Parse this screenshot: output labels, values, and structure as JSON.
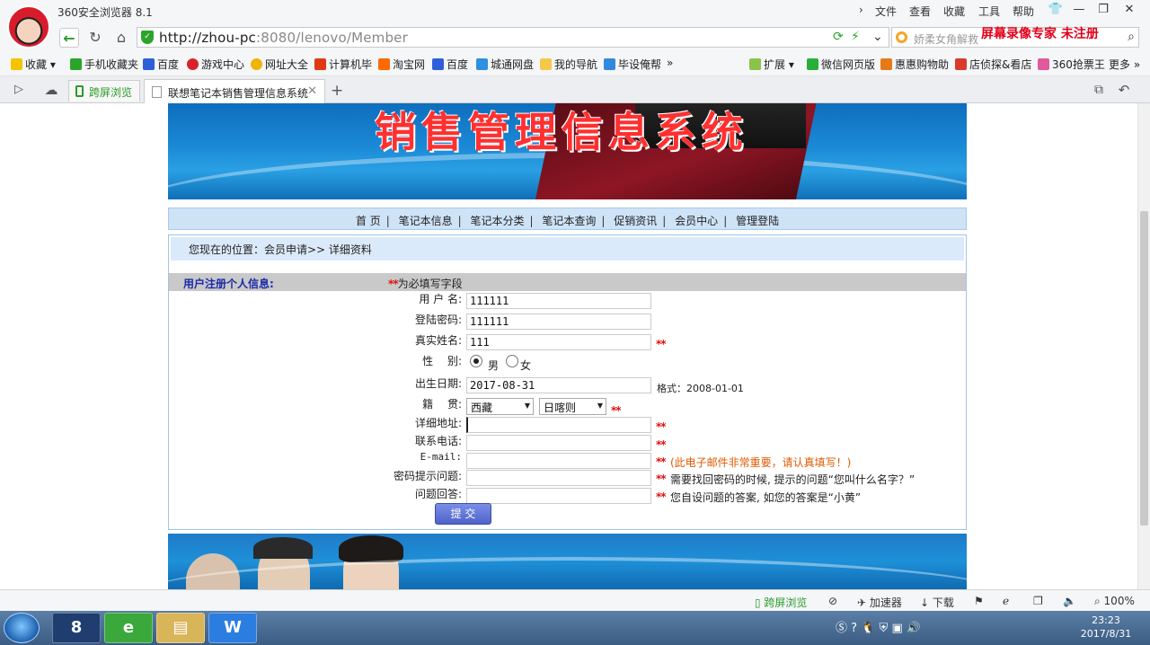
{
  "browser": {
    "app_title": "360安全浏览器 8.1",
    "menus": [
      "文件",
      "查看",
      "收藏",
      "工具",
      "帮助"
    ],
    "url_host": "http://zhou-pc",
    "url_path": ":8080/lenovo/Member",
    "search_placeholder": "娇柔女角解救",
    "watermark": "屏幕录像专家  未注册",
    "bookmarks": [
      "收藏",
      "手机收藏夹",
      "百度",
      "游戏中心",
      "网址大全",
      "计算机毕",
      "淘宝网",
      "百度",
      "城通网盘",
      "我的导航",
      "毕设俺帮"
    ],
    "bookmarks_right": [
      "扩展",
      "微信网页版",
      "惠惠购物助",
      "店侦探&看店",
      "360抢票王",
      "更多"
    ],
    "tabs": {
      "split_label": "跨屏浏览",
      "active_label": "联想笔记本销售管理信息系统"
    },
    "status": {
      "split_label": "跨屏浏览",
      "accelerator": "加速器",
      "download": "下载",
      "zoom": "100%"
    },
    "clock": {
      "time": "23:23",
      "date": "2017/8/31"
    }
  },
  "page": {
    "banner_title": "销售管理信息系统",
    "nav": [
      "首 页",
      "笔记本信息",
      "笔记本分类",
      "笔记本查询",
      "促销资讯",
      "会员中心",
      "管理登陆"
    ],
    "location": "您现在的位置：会员申请>> 详细资料",
    "section_title": "用户注册个人信息:",
    "required_mark": "**",
    "required_note": "为必填写字段",
    "form": {
      "username_label": "用 户 名:",
      "username_value": "111111",
      "password_label": "登陆密码:",
      "password_value": "111111",
      "realname_label": "真实姓名:",
      "realname_value": "111",
      "gender_label": "性　 别:",
      "gender_male": "男",
      "gender_female": "女",
      "gender_selected": "男",
      "birthday_label": "出生日期:",
      "birthday_value": "2017-08-31",
      "birthday_format": "格式：2008-01-01",
      "native_label": "籍　 贯:",
      "province_value": "西藏",
      "city_value": "日喀则",
      "address_label": "详细地址:",
      "address_value": "",
      "phone_label": "联系电话:",
      "phone_value": "",
      "email_label": "E-mail:",
      "email_value": "",
      "email_note": "(此电子邮件非常重要，请认真填写！)",
      "question_label": "密码提示问题:",
      "question_value": "",
      "question_note": "需要找回密码的时候, 提示的问题“您叫什么名字？”",
      "answer_label": "问题回答:",
      "answer_value": "",
      "answer_note": "您自设问题的答案, 如您的答案是“小黄”",
      "submit_label": "提 交"
    }
  },
  "colors": {
    "accent_blue": "#1a2aa8",
    "required_red": "#e01010",
    "note_orange": "#e05a00",
    "nav_bg": "#cfe3f7"
  }
}
